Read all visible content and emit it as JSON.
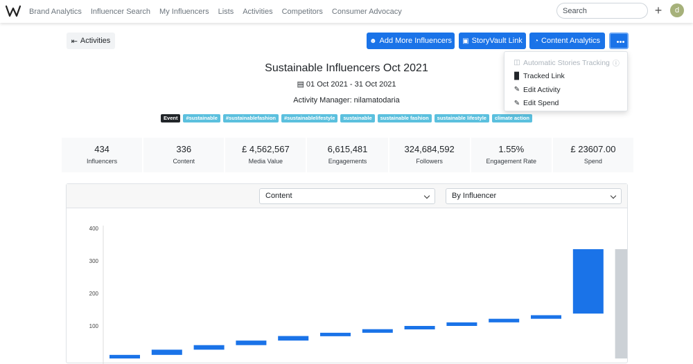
{
  "nav": {
    "links": [
      "Brand Analytics",
      "Influencer Search",
      "My Influencers",
      "Lists",
      "Activities",
      "Competitors",
      "Consumer Advocacy"
    ],
    "search_placeholder": "Search",
    "avatar_letter": "d"
  },
  "toolbar": {
    "back_label": "Activities",
    "add_influencers": "Add More Influencers",
    "storyvault": "StoryVault Link",
    "content_analytics": "Content Analytics"
  },
  "dropdown": {
    "items": [
      "Automatic Stories Tracking",
      "Tracked Link",
      "Edit Activity",
      "Edit Spend"
    ]
  },
  "header": {
    "title": "Sustainable Influencers Oct 2021",
    "date_range": "01 Oct 2021 - 31 Oct 2021",
    "manager": "Activity Manager: nilamatodaria"
  },
  "tags": [
    "Event",
    "#sustainable",
    "#sustainablefashion",
    "#sustainablelifestyle",
    "sustainable",
    "sustainable fashion",
    "sustainable lifestyle",
    "climate action"
  ],
  "stats": [
    {
      "value": "434",
      "label": "Influencers"
    },
    {
      "value": "336",
      "label": "Content"
    },
    {
      "value": "£ 4,562,567",
      "label": "Media Value"
    },
    {
      "value": "6,615,481",
      "label": "Engagements"
    },
    {
      "value": "324,684,592",
      "label": "Followers"
    },
    {
      "value": "1.55%",
      "label": "Engagement Rate"
    },
    {
      "value": "£ 23607.00",
      "label": "Spend"
    }
  ],
  "filters": {
    "metric": "Content",
    "group": "By Influencer"
  },
  "colors": {
    "primary": "#1a73e8",
    "tag": "#5bc0de",
    "total_bar": "#ccd1d6"
  },
  "chart_data": {
    "type": "bar",
    "subtype": "waterfall",
    "y_ticks": [
      100,
      200,
      300,
      400
    ],
    "ylim": [
      0,
      400
    ],
    "bars": [
      {
        "low": 0,
        "high": 11
      },
      {
        "low": 11,
        "high": 27
      },
      {
        "low": 27,
        "high": 41
      },
      {
        "low": 41,
        "high": 55
      },
      {
        "low": 55,
        "high": 69
      },
      {
        "low": 69,
        "high": 79
      },
      {
        "low": 79,
        "high": 90
      },
      {
        "low": 90,
        "high": 100
      },
      {
        "low": 100,
        "high": 111
      },
      {
        "low": 111,
        "high": 122
      },
      {
        "low": 122,
        "high": 133
      },
      {
        "low": 138,
        "high": 336
      },
      {
        "low": 0,
        "high": 336,
        "total": true
      }
    ]
  }
}
